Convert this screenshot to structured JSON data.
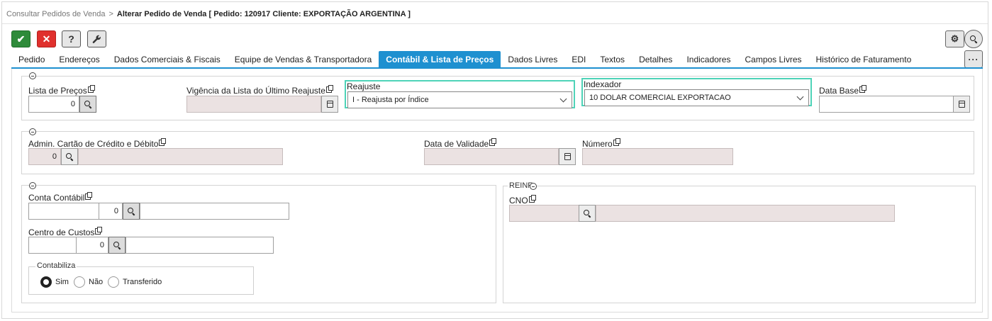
{
  "breadcrumb": {
    "parent": "Consultar Pedidos de Venda",
    "separator": ">",
    "current": "Alterar Pedido de Venda [ Pedido: 120917 Cliente: EXPORTAÇÃO ARGENTINA ]"
  },
  "toolbar": {
    "confirm_icon": "✔",
    "cancel_icon": "✕",
    "help_label": "?",
    "tool_icon": "wrench-icon",
    "gear_icon": "⚙",
    "more_label": "···"
  },
  "tabs": [
    {
      "label": "Pedido"
    },
    {
      "label": "Endereços"
    },
    {
      "label": "Dados Comerciais & Fiscais"
    },
    {
      "label": "Equipe de Vendas & Transportadora"
    },
    {
      "label": "Contábil & Lista de Preços",
      "active": true
    },
    {
      "label": "Dados Livres"
    },
    {
      "label": "EDI"
    },
    {
      "label": "Textos"
    },
    {
      "label": "Detalhes"
    },
    {
      "label": "Indicadores"
    },
    {
      "label": "Campos Livres"
    },
    {
      "label": "Histórico de Faturamento"
    }
  ],
  "section1": {
    "lista_precos": {
      "label": "Lista de Preços",
      "value": "0"
    },
    "vigencia": {
      "label": "Vigência da Lista do Último Reajuste",
      "value": ""
    },
    "reajuste": {
      "label": "Reajuste",
      "value": "I - Reajusta por Índice"
    },
    "indexador": {
      "label": "Indexador",
      "value": "10 DOLAR COMERCIAL EXPORTACAO"
    },
    "data_base": {
      "label": "Data Base",
      "value": ""
    }
  },
  "section2": {
    "admin_cartao": {
      "label": "Admin. Cartão de Crédito e Débito",
      "value": "0",
      "description": ""
    },
    "data_validade": {
      "label": "Data de Validade",
      "value": ""
    },
    "numero": {
      "label": "Número",
      "value": ""
    }
  },
  "section3": {
    "conta_contabil": {
      "label": "Conta Contábil",
      "code": "",
      "value": "0",
      "description": ""
    },
    "centro_custos": {
      "label": "Centro de Custos",
      "code": "",
      "value": "0",
      "description": ""
    },
    "contabiliza": {
      "legend": "Contabiliza",
      "options": [
        "Sim",
        "Não",
        "Transferido"
      ],
      "selected": "Sim"
    }
  },
  "reinf": {
    "legend": "REINF",
    "cno": {
      "label": "CNO",
      "value": "",
      "description": ""
    }
  },
  "colors": {
    "accent": "#1e90d0",
    "confirm": "#2e8b3a",
    "cancel": "#e0302d",
    "focus_border": "#4fd3b8",
    "disabled_bg": "#ebe2e2"
  }
}
